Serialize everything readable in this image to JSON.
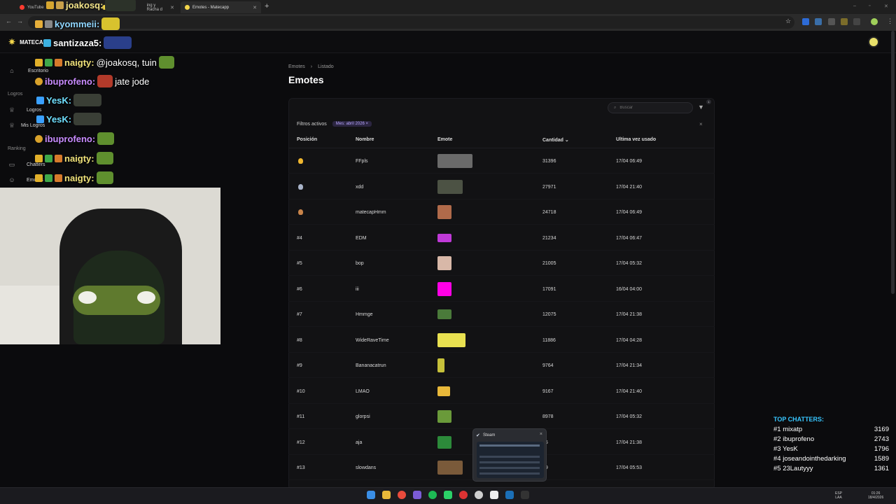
{
  "browser": {
    "tabs": [
      {
        "label": "YouTube",
        "color": "#ff3b30"
      },
      {
        "label": "ing y Racha d",
        "color": "#f3d64b"
      },
      {
        "label": "Emotes - Matecapp",
        "color": "#f3d64b"
      }
    ],
    "new_tab": "+",
    "window_controls": [
      "–",
      "▫",
      "✕"
    ]
  },
  "app": {
    "brand": "MATECAPP",
    "sidebar": {
      "items": [
        {
          "label": "Escritorio",
          "icon": "home-icon"
        },
        {
          "label": "Logros",
          "icon": "trophy-icon"
        },
        {
          "label": "Mis Logros",
          "icon": "trophy-icon"
        },
        {
          "label": "Chatters",
          "icon": "chat-icon"
        },
        {
          "label": "Emotes",
          "icon": "smile-icon"
        }
      ],
      "sections": [
        "Logros",
        "Ranking"
      ]
    }
  },
  "chat_overlay": [
    {
      "user": "joakosq:",
      "color": "#f4e58a",
      "msg": ""
    },
    {
      "user": "kyommeii:",
      "color": "#8fd6ff",
      "msg": ""
    },
    {
      "user": "santizaza5:",
      "color": "#ffffff",
      "msg": ""
    },
    {
      "user": "naigty:",
      "color": "#f0e27a",
      "msg": "@joakosq, tuin"
    },
    {
      "user": "ibuprofeno:",
      "color": "#c88bff",
      "msg": "jate jode"
    },
    {
      "user": "YesK:",
      "color": "#6fe0ff",
      "msg": ""
    },
    {
      "user": "YesK:",
      "color": "#6fe0ff",
      "msg": ""
    },
    {
      "user": "ibuprofeno:",
      "color": "#c88bff",
      "msg": ""
    },
    {
      "user": "naigty:",
      "color": "#f0e27a",
      "msg": ""
    },
    {
      "user": "naigty:",
      "color": "#f0e27a",
      "msg": ""
    }
  ],
  "breadcrumb": {
    "root": "Emotes",
    "sep": "›",
    "current": "Listado"
  },
  "page_title": "Emotes",
  "search": {
    "placeholder": "Buscar"
  },
  "filter_badge": "1",
  "filters": {
    "label": "Filtros activos",
    "chip": "Mes: abril 2026 ×",
    "close": "×"
  },
  "table": {
    "headers": {
      "position": "Posición",
      "name": "Nombre",
      "emote": "Emote",
      "count": "Cantidad ⌄",
      "last": "Ultima vez usado"
    },
    "rows": [
      {
        "pos": "",
        "medal": "#f0b72f",
        "name": "FFpls",
        "count": "31396",
        "last": "17/04 06:49"
      },
      {
        "pos": "",
        "medal": "#a9b4c9",
        "name": "xdd",
        "count": "27971",
        "last": "17/04 21:40"
      },
      {
        "pos": "",
        "medal": "#c9844a",
        "name": "matecapHmm",
        "count": "24718",
        "last": "17/04 06:49"
      },
      {
        "pos": "#4",
        "medal": "",
        "name": "EDM",
        "count": "21234",
        "last": "17/04 06:47"
      },
      {
        "pos": "#5",
        "medal": "",
        "name": "bop",
        "count": "21005",
        "last": "17/04 05:32"
      },
      {
        "pos": "#6",
        "medal": "",
        "name": "iii",
        "count": "17091",
        "last": "16/04 04:00"
      },
      {
        "pos": "#7",
        "medal": "",
        "name": "Hmmge",
        "count": "12075",
        "last": "17/04 21:38"
      },
      {
        "pos": "#8",
        "medal": "",
        "name": "WideRaveTime",
        "count": "11886",
        "last": "17/04 04:28"
      },
      {
        "pos": "#9",
        "medal": "",
        "name": "Bananacatrun",
        "count": "9764",
        "last": "17/04 21:34"
      },
      {
        "pos": "#10",
        "medal": "",
        "name": "LMAO",
        "count": "9167",
        "last": "17/04 21:40"
      },
      {
        "pos": "#11",
        "medal": "",
        "name": "glorpsi",
        "count": "8978",
        "last": "17/04 05:32"
      },
      {
        "pos": "#12",
        "medal": "",
        "name": "aja",
        "count": "16",
        "last": "17/04 21:38"
      },
      {
        "pos": "#13",
        "medal": "",
        "name": "slowdans",
        "count": "29",
        "last": "17/04 05:53"
      }
    ]
  },
  "steam_popup": {
    "title": "Steam",
    "close": "×"
  },
  "top_chatters": {
    "title": "TOP CHATTERS:",
    "rows": [
      {
        "rank": "#1 mixatp",
        "count": "3169"
      },
      {
        "rank": "#2 ibuprofeno",
        "count": "2743"
      },
      {
        "rank": "#3 YesK",
        "count": "1796"
      },
      {
        "rank": "#4 joseandointhedarking",
        "count": "1589"
      },
      {
        "rank": "#5 23Lautyyy",
        "count": "1361"
      }
    ]
  },
  "taskbar": {
    "lang": "ESP",
    "lang2": "LAA",
    "time": "01:26",
    "date": "18/4/2026"
  }
}
